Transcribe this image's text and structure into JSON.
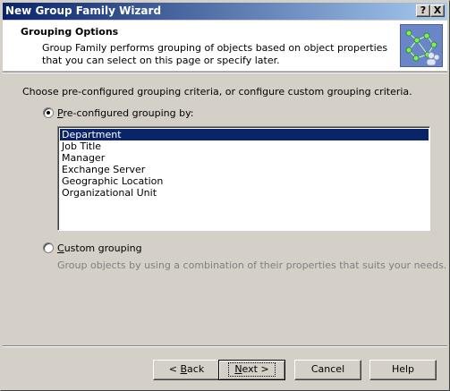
{
  "window": {
    "title": "New Group Family Wizard",
    "help_glyph": "?",
    "close_glyph": "X"
  },
  "header": {
    "title": "Grouping Options",
    "description": "Group Family performs grouping of objects based on object properties that you can select on this page or specify later.",
    "icon": "group-family-wizard-icon"
  },
  "prompt": "Choose pre-configured grouping criteria, or configure custom grouping criteria.",
  "preconfigured": {
    "label_access": "P",
    "label_rest": "re-configured grouping by:",
    "checked": true,
    "options": [
      "Department",
      "Job Title",
      "Manager",
      "Exchange Server",
      "Geographic Location",
      "Organizational Unit"
    ],
    "selected": "Department"
  },
  "custom": {
    "label_access": "C",
    "label_rest": "ustom grouping",
    "checked": false,
    "description": "Group objects by using a combination of their properties that suits your needs."
  },
  "buttons": {
    "back_prefix": "< ",
    "back_access": "B",
    "back_rest": "ack",
    "next_access": "N",
    "next_rest": "ext >",
    "cancel": "Cancel",
    "help": "Help"
  },
  "colors": {
    "face": "#d4d0c8",
    "titlebar_start": "#0a246a",
    "titlebar_end": "#a6caf0",
    "selection": "#0a246a",
    "disabled_text": "#808080"
  }
}
